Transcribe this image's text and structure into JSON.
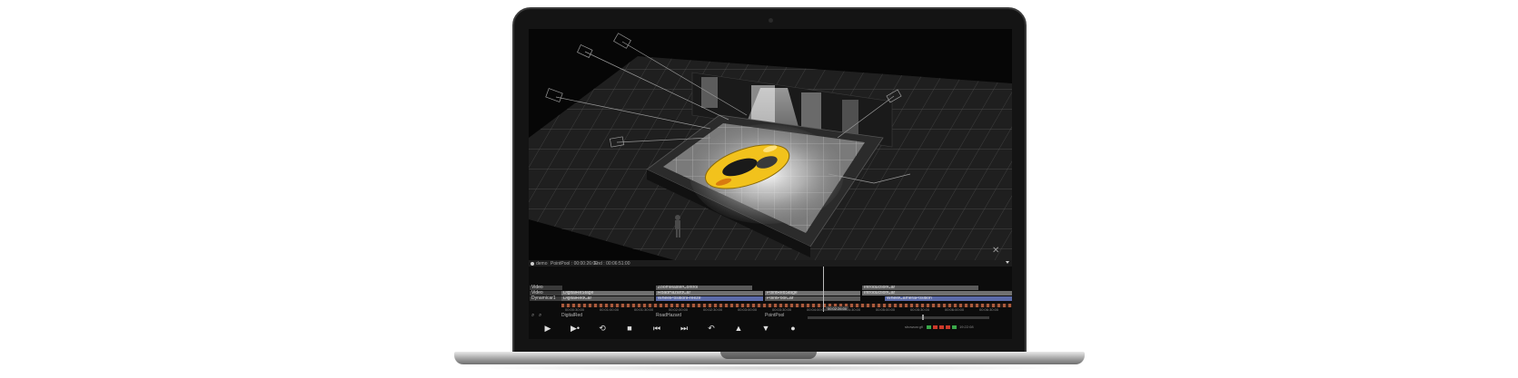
{
  "timeline": {
    "header": {
      "name": "demo",
      "position": "PointPool : 00:00:26:00",
      "end": "End : 00:06:51:00"
    },
    "tracks": [
      {
        "label": "Video"
      },
      {
        "label": "Video"
      },
      {
        "label": "Dynamicar1"
      }
    ],
    "clips": {
      "video1": [
        "ZoomMasterControl",
        "IntroductionCar"
      ],
      "video2": [
        "DigitalReStage",
        "RoadHazardCar",
        "PointRedStage",
        "IntroductionCar"
      ],
      "dynamic": [
        "DigitalRedCar",
        "WheelPositionFreeze",
        "PointPoolCar",
        "WheelCameraPosition"
      ]
    },
    "ticks": [
      "00:00:30:00",
      "00:01:00:00",
      "00:01:30:00",
      "00:02:00:00",
      "00:02:30:00",
      "00:03:00:00",
      "00:03:30:00",
      "00:04:00:00",
      "00:04:30:00",
      "00:05:00:00",
      "00:05:30:00",
      "00:06:00:00",
      "00:06:30:00"
    ],
    "current_time": "00:02:26:00",
    "cues": [
      "DigitalRed",
      "RoadHazard",
      "PointPool"
    ],
    "status": {
      "left": "showcar.gfl",
      "right": "19:22:08"
    }
  },
  "transport": [
    {
      "label": "▶",
      "icon": "play-icon"
    },
    {
      "label": "▶•",
      "icon": "play-to-next-icon"
    },
    {
      "label": "⟲",
      "icon": "loop-icon"
    },
    {
      "label": "■",
      "icon": "stop-icon"
    },
    {
      "label": "⏮",
      "icon": "previous-icon"
    },
    {
      "label": "⏭",
      "icon": "next-icon"
    },
    {
      "label": "↶",
      "icon": "undo-icon"
    },
    {
      "label": "▲",
      "icon": "up-icon"
    },
    {
      "label": "▼",
      "icon": "down-icon"
    },
    {
      "label": "●",
      "icon": "record-icon"
    }
  ],
  "colors": {
    "record_indicator": "#cc3a2a",
    "ok_indicator": "#3aa84a",
    "clip_blue": "#5b6aa8",
    "car_yellow": "#f2c21c"
  }
}
